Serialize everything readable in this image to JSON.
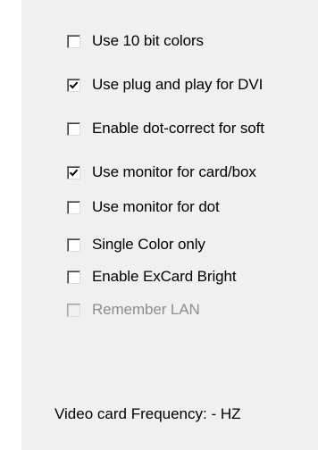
{
  "options": [
    {
      "label": "Use 10 bit colors",
      "checked": false,
      "disabled": false
    },
    {
      "label": "Use plug and play for DVI",
      "checked": true,
      "disabled": false
    },
    {
      "label": "Enable dot-correct for soft",
      "checked": false,
      "disabled": false
    },
    {
      "label": "Use monitor for card/box",
      "checked": true,
      "disabled": false
    },
    {
      "label": "Use monitor for dot",
      "checked": false,
      "disabled": false
    },
    {
      "label": "Single Color only",
      "checked": false,
      "disabled": false
    },
    {
      "label": "Enable ExCard Bright",
      "checked": false,
      "disabled": false
    },
    {
      "label": "Remember LAN",
      "checked": false,
      "disabled": true
    }
  ],
  "frequency": {
    "text": "Video card Frequency: - HZ"
  },
  "colors": {
    "panel": "#f0f0f0",
    "disabled_text": "#8d8d8d"
  }
}
